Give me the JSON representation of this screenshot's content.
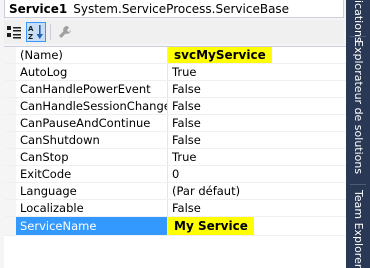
{
  "object_selector": {
    "name": "Service1",
    "type": "System.ServiceProcess.ServiceBase"
  },
  "toolbar": {
    "buttons": [
      {
        "icon": "categorized-icon",
        "active": false
      },
      {
        "icon": "alphabetical-icon",
        "active": true
      },
      {
        "icon": "property-pages-icon",
        "active": false
      }
    ]
  },
  "properties": [
    {
      "name": "(Name)",
      "value": "svcMyService"
    },
    {
      "name": "AutoLog",
      "value": "True"
    },
    {
      "name": "CanHandlePowerEvent",
      "value": "False"
    },
    {
      "name": "CanHandleSessionChangeEvent",
      "value": "False"
    },
    {
      "name": "CanPauseAndContinue",
      "value": "False"
    },
    {
      "name": "CanShutdown",
      "value": "False"
    },
    {
      "name": "CanStop",
      "value": "True"
    },
    {
      "name": "ExitCode",
      "value": "0"
    },
    {
      "name": "Language",
      "value": "(Par défaut)"
    },
    {
      "name": "Localizable",
      "value": "False"
    },
    {
      "name": "ServiceName",
      "value": "My Service"
    }
  ],
  "side_tabs": [
    "ications",
    "Explorateur de solutions",
    "Team Explorer"
  ],
  "colors": {
    "highlight": "#ffff00",
    "selection": "#3399ff",
    "side_panel": "#293955"
  }
}
